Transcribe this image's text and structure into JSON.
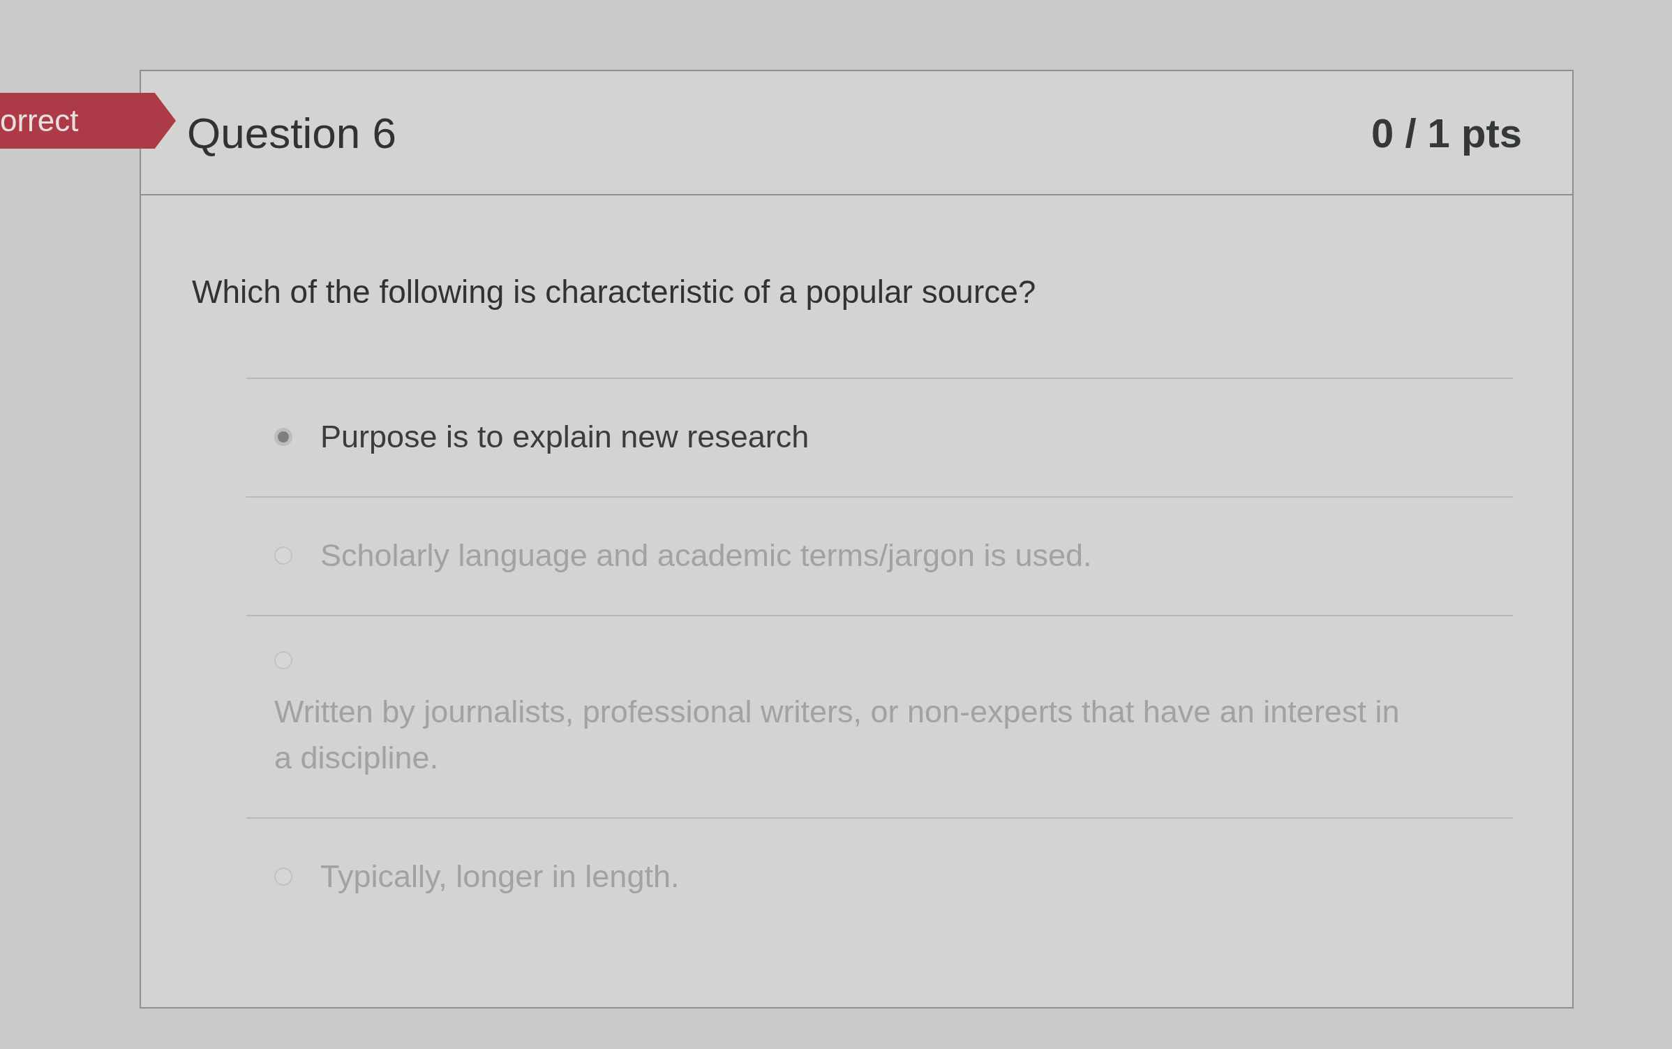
{
  "result_flag": {
    "text": "orrect"
  },
  "question": {
    "title": "Question 6",
    "points": "0 / 1 pts",
    "text": "Which of the following is characteristic of a popular source?"
  },
  "answers": [
    {
      "text": "Purpose is to explain new research",
      "selected": true
    },
    {
      "text": "Scholarly language and academic terms/jargon is used.",
      "selected": false
    },
    {
      "text": "Written by journalists, professional writers, or non-experts that have an interest in a discipline.",
      "selected": false
    },
    {
      "text": "Typically, longer in length.",
      "selected": false
    }
  ]
}
